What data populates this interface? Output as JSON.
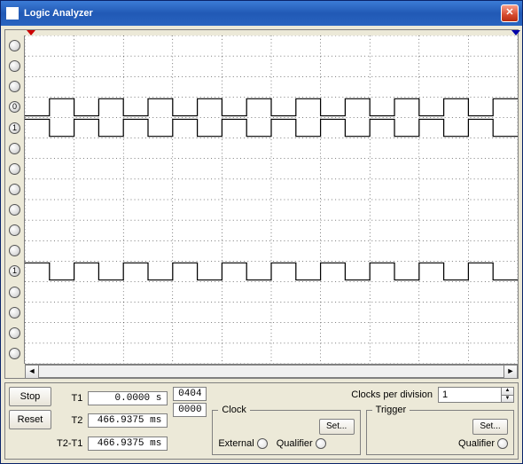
{
  "window": {
    "title": "Logic Analyzer"
  },
  "channels": [
    {
      "label": ""
    },
    {
      "label": ""
    },
    {
      "label": ""
    },
    {
      "label": "0"
    },
    {
      "label": "1"
    },
    {
      "label": ""
    },
    {
      "label": ""
    },
    {
      "label": ""
    },
    {
      "label": ""
    },
    {
      "label": ""
    },
    {
      "label": ""
    },
    {
      "label": "1"
    },
    {
      "label": ""
    },
    {
      "label": ""
    },
    {
      "label": ""
    },
    {
      "label": ""
    }
  ],
  "markers": {
    "t1_index": "1",
    "t2_index": "2"
  },
  "buttons": {
    "stop": "Stop",
    "reset": "Reset",
    "set": "Set..."
  },
  "time": {
    "t1_label": "T1",
    "t2_label": "T2",
    "diff_label": "T2-T1",
    "t1_value": "0.0000 s",
    "t2_value": "466.9375 ms",
    "diff_value": "466.9375 ms"
  },
  "hex": {
    "top": "0404",
    "bottom": "0000"
  },
  "clocks": {
    "per_div_label": "Clocks per division",
    "per_div_value": "1",
    "group_label": "Clock",
    "external_label": "External",
    "qualifier_label": "Qualifier"
  },
  "trigger": {
    "group_label": "Trigger",
    "qualifier_label": "Qualifier"
  },
  "chart_data": {
    "type": "logic-timeline",
    "channels_total": 16,
    "time_divisions": 10,
    "clocks_per_division": 1,
    "t1_position_div": 0.0,
    "t2_position_div": 10.0,
    "waveforms": [
      {
        "channel": 3,
        "pattern": "square",
        "period_divisions": 1.0,
        "duty": 0.5,
        "initial": 0
      },
      {
        "channel": 4,
        "pattern": "square",
        "period_divisions": 1.0,
        "duty": 0.5,
        "initial": 1
      },
      {
        "channel": 11,
        "pattern": "square",
        "period_divisions": 1.0,
        "duty": 0.5,
        "initial": 1
      }
    ]
  }
}
